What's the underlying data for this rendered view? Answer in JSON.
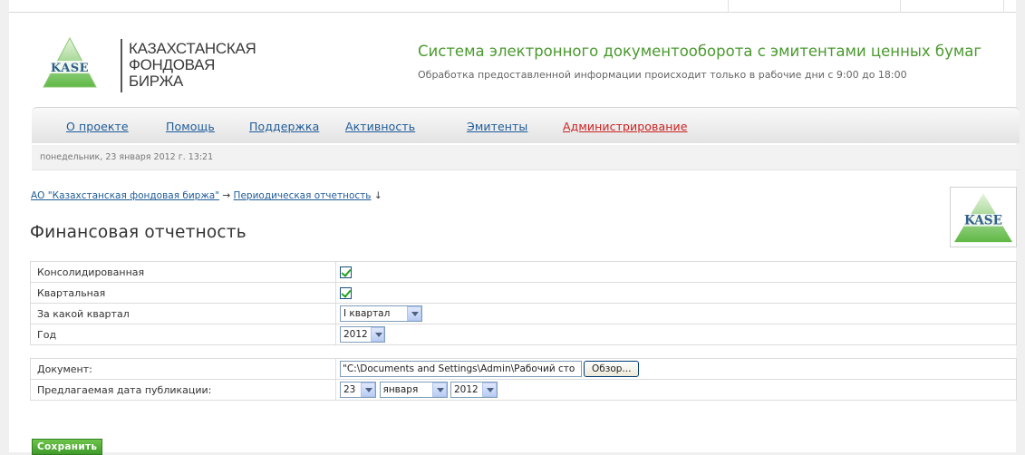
{
  "logo": {
    "abbr": "KASE",
    "line1": "КАЗАХСТАНСКАЯ",
    "line2": "ФОНДОВАЯ",
    "line3": "БИРЖА"
  },
  "header": {
    "title": "Система электронного документооборота с эмитентами ценных бумаг",
    "subtitle": "Обработка предоставленной информации происходит только в рабочие дни с 9:00 до 18:00"
  },
  "nav": {
    "items": [
      {
        "label": "О проекте"
      },
      {
        "label": "Помощь"
      },
      {
        "label": "Поддержка"
      },
      {
        "label": "Активность"
      },
      {
        "label": "Эмитенты"
      },
      {
        "label": "Администрирование"
      }
    ]
  },
  "datetime": "понедельник, 23 января 2012 г. 13:21",
  "breadcrumb": {
    "root": "АО \"Казахстанская фондовая биржа\"",
    "separator": "→",
    "current": "Периодическая отчетность",
    "arrow": "↓"
  },
  "page_title": "Финансовая отчетность",
  "form": {
    "consolidated_label": "Консолидированная",
    "consolidated_checked": true,
    "quarterly_label": "Квартальная",
    "quarterly_checked": true,
    "quarter_label": "За какой квартал",
    "quarter_value": "I квартал",
    "year_label": "Год",
    "year_value": "2012",
    "document_label": "Документ:",
    "document_value": "\"C:\\Documents and Settings\\Admin\\Рабочий сто",
    "browse_label": "Обзор...",
    "pubdate_label": "Предлагаемая дата публикации:",
    "pub_day": "23",
    "pub_month": "января",
    "pub_year": "2012"
  },
  "save_label": "Сохранить",
  "colors": {
    "title_green": "#4a9a2e",
    "link_blue": "#1f5c99",
    "admin_red": "#cc2222",
    "save_green": "#4aa832"
  }
}
